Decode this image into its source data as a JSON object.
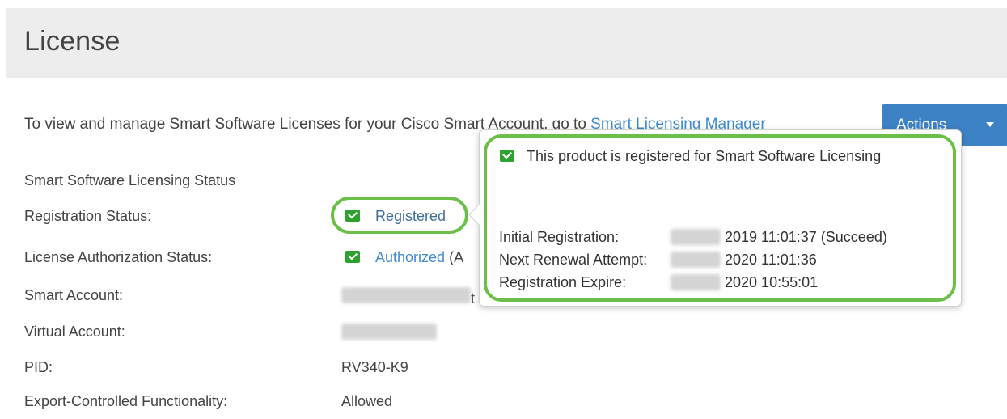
{
  "header": {
    "title": "License"
  },
  "intro": {
    "text": "To view and manage Smart Software Licenses for your Cisco Smart Account, go to ",
    "link": "Smart Licensing Manager"
  },
  "actions": {
    "label": "Actions"
  },
  "status": {
    "section_title": "Smart Software Licensing Status",
    "rows": [
      {
        "label": "Registration Status:",
        "value": "Registered"
      },
      {
        "label": "License Authorization Status:",
        "value": "Authorized",
        "suffix": "(A"
      },
      {
        "label": "Smart Account:",
        "value": "",
        "suffix": "t"
      },
      {
        "label": "Virtual Account:",
        "value": ""
      },
      {
        "label": "PID:",
        "value": "RV340-K9"
      },
      {
        "label": "Export-Controlled Functionality:",
        "value": "Allowed"
      }
    ]
  },
  "popover": {
    "heading": "This product is registered for Smart Software Licensing",
    "rows": [
      {
        "label": "Initial Registration:",
        "value": "2019 11:01:37 (Succeed)"
      },
      {
        "label": "Next Renewal Attempt:",
        "value": "2020 11:01:36"
      },
      {
        "label": "Registration Expire:",
        "value": "2020 10:55:01"
      }
    ]
  },
  "colors": {
    "accent": "#3d82c4",
    "link": "#3f8ad1",
    "check": "#2ea12e",
    "highlight_ring": "#6cc04a",
    "header_bg": "#ededed"
  }
}
